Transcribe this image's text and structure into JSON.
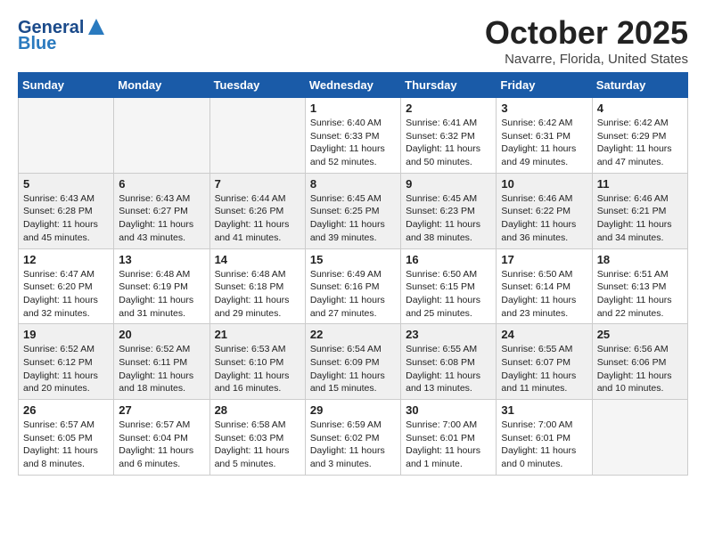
{
  "header": {
    "logo_line1": "General",
    "logo_line2": "Blue",
    "month": "October 2025",
    "location": "Navarre, Florida, United States"
  },
  "weekdays": [
    "Sunday",
    "Monday",
    "Tuesday",
    "Wednesday",
    "Thursday",
    "Friday",
    "Saturday"
  ],
  "weeks": [
    [
      {
        "day": "",
        "info": ""
      },
      {
        "day": "",
        "info": ""
      },
      {
        "day": "",
        "info": ""
      },
      {
        "day": "1",
        "info": "Sunrise: 6:40 AM\nSunset: 6:33 PM\nDaylight: 11 hours\nand 52 minutes."
      },
      {
        "day": "2",
        "info": "Sunrise: 6:41 AM\nSunset: 6:32 PM\nDaylight: 11 hours\nand 50 minutes."
      },
      {
        "day": "3",
        "info": "Sunrise: 6:42 AM\nSunset: 6:31 PM\nDaylight: 11 hours\nand 49 minutes."
      },
      {
        "day": "4",
        "info": "Sunrise: 6:42 AM\nSunset: 6:29 PM\nDaylight: 11 hours\nand 47 minutes."
      }
    ],
    [
      {
        "day": "5",
        "info": "Sunrise: 6:43 AM\nSunset: 6:28 PM\nDaylight: 11 hours\nand 45 minutes."
      },
      {
        "day": "6",
        "info": "Sunrise: 6:43 AM\nSunset: 6:27 PM\nDaylight: 11 hours\nand 43 minutes."
      },
      {
        "day": "7",
        "info": "Sunrise: 6:44 AM\nSunset: 6:26 PM\nDaylight: 11 hours\nand 41 minutes."
      },
      {
        "day": "8",
        "info": "Sunrise: 6:45 AM\nSunset: 6:25 PM\nDaylight: 11 hours\nand 39 minutes."
      },
      {
        "day": "9",
        "info": "Sunrise: 6:45 AM\nSunset: 6:23 PM\nDaylight: 11 hours\nand 38 minutes."
      },
      {
        "day": "10",
        "info": "Sunrise: 6:46 AM\nSunset: 6:22 PM\nDaylight: 11 hours\nand 36 minutes."
      },
      {
        "day": "11",
        "info": "Sunrise: 6:46 AM\nSunset: 6:21 PM\nDaylight: 11 hours\nand 34 minutes."
      }
    ],
    [
      {
        "day": "12",
        "info": "Sunrise: 6:47 AM\nSunset: 6:20 PM\nDaylight: 11 hours\nand 32 minutes."
      },
      {
        "day": "13",
        "info": "Sunrise: 6:48 AM\nSunset: 6:19 PM\nDaylight: 11 hours\nand 31 minutes."
      },
      {
        "day": "14",
        "info": "Sunrise: 6:48 AM\nSunset: 6:18 PM\nDaylight: 11 hours\nand 29 minutes."
      },
      {
        "day": "15",
        "info": "Sunrise: 6:49 AM\nSunset: 6:16 PM\nDaylight: 11 hours\nand 27 minutes."
      },
      {
        "day": "16",
        "info": "Sunrise: 6:50 AM\nSunset: 6:15 PM\nDaylight: 11 hours\nand 25 minutes."
      },
      {
        "day": "17",
        "info": "Sunrise: 6:50 AM\nSunset: 6:14 PM\nDaylight: 11 hours\nand 23 minutes."
      },
      {
        "day": "18",
        "info": "Sunrise: 6:51 AM\nSunset: 6:13 PM\nDaylight: 11 hours\nand 22 minutes."
      }
    ],
    [
      {
        "day": "19",
        "info": "Sunrise: 6:52 AM\nSunset: 6:12 PM\nDaylight: 11 hours\nand 20 minutes."
      },
      {
        "day": "20",
        "info": "Sunrise: 6:52 AM\nSunset: 6:11 PM\nDaylight: 11 hours\nand 18 minutes."
      },
      {
        "day": "21",
        "info": "Sunrise: 6:53 AM\nSunset: 6:10 PM\nDaylight: 11 hours\nand 16 minutes."
      },
      {
        "day": "22",
        "info": "Sunrise: 6:54 AM\nSunset: 6:09 PM\nDaylight: 11 hours\nand 15 minutes."
      },
      {
        "day": "23",
        "info": "Sunrise: 6:55 AM\nSunset: 6:08 PM\nDaylight: 11 hours\nand 13 minutes."
      },
      {
        "day": "24",
        "info": "Sunrise: 6:55 AM\nSunset: 6:07 PM\nDaylight: 11 hours\nand 11 minutes."
      },
      {
        "day": "25",
        "info": "Sunrise: 6:56 AM\nSunset: 6:06 PM\nDaylight: 11 hours\nand 10 minutes."
      }
    ],
    [
      {
        "day": "26",
        "info": "Sunrise: 6:57 AM\nSunset: 6:05 PM\nDaylight: 11 hours\nand 8 minutes."
      },
      {
        "day": "27",
        "info": "Sunrise: 6:57 AM\nSunset: 6:04 PM\nDaylight: 11 hours\nand 6 minutes."
      },
      {
        "day": "28",
        "info": "Sunrise: 6:58 AM\nSunset: 6:03 PM\nDaylight: 11 hours\nand 5 minutes."
      },
      {
        "day": "29",
        "info": "Sunrise: 6:59 AM\nSunset: 6:02 PM\nDaylight: 11 hours\nand 3 minutes."
      },
      {
        "day": "30",
        "info": "Sunrise: 7:00 AM\nSunset: 6:01 PM\nDaylight: 11 hours\nand 1 minute."
      },
      {
        "day": "31",
        "info": "Sunrise: 7:00 AM\nSunset: 6:01 PM\nDaylight: 11 hours\nand 0 minutes."
      },
      {
        "day": "",
        "info": ""
      }
    ]
  ]
}
